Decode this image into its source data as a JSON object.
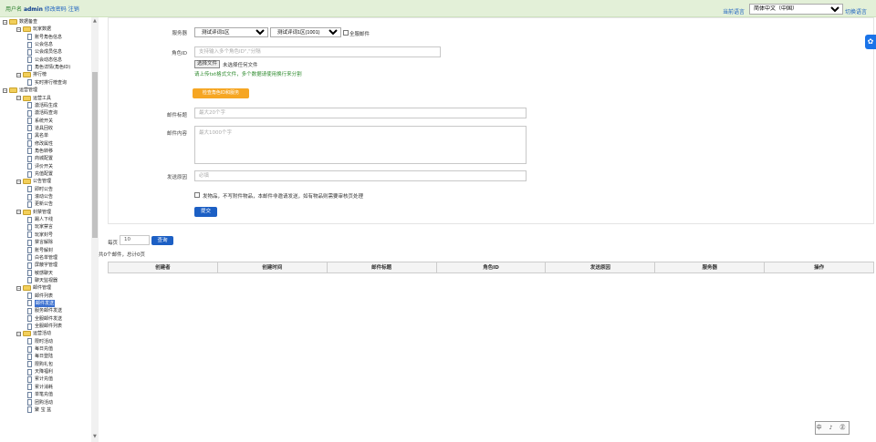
{
  "topbar": {
    "user_prefix": "用户名",
    "username": "admin",
    "change_password": "修改密码",
    "logout": "注销",
    "language_label": "当前语言",
    "language_value": "简体中文（中国）",
    "switch_language": "切换语言"
  },
  "sidebar": {
    "items": [
      {
        "label": "数据备查",
        "type": "folder",
        "level": 0
      },
      {
        "label": "玩家数据",
        "type": "folder",
        "level": 1
      },
      {
        "label": "账号角色信息",
        "type": "doc",
        "level": 2
      },
      {
        "label": "公会信息",
        "type": "doc",
        "level": 2
      },
      {
        "label": "公会成员信息",
        "type": "doc",
        "level": 2
      },
      {
        "label": "公会动态信息",
        "type": "doc",
        "level": 2
      },
      {
        "label": "角色详情(角色ID)",
        "type": "doc",
        "level": 2
      },
      {
        "label": "排行榜",
        "type": "folder",
        "level": 1
      },
      {
        "label": "实时排行榜查询",
        "type": "doc",
        "level": 2
      },
      {
        "label": "运营管理",
        "type": "folder",
        "level": 0
      },
      {
        "label": "运营工具",
        "type": "folder",
        "level": 1
      },
      {
        "label": "激活码生成",
        "type": "doc",
        "level": 2
      },
      {
        "label": "激活码查询",
        "type": "doc",
        "level": 2
      },
      {
        "label": "系统开关",
        "type": "doc",
        "level": 2
      },
      {
        "label": "道具回收",
        "type": "doc",
        "level": 2
      },
      {
        "label": "黑名单",
        "type": "doc",
        "level": 2
      },
      {
        "label": "修改属性",
        "type": "doc",
        "level": 2
      },
      {
        "label": "角色转移",
        "type": "doc",
        "level": 2
      },
      {
        "label": "商城配置",
        "type": "doc",
        "level": 2
      },
      {
        "label": "评价开关",
        "type": "doc",
        "level": 2
      },
      {
        "label": "充值配置",
        "type": "doc",
        "level": 2
      },
      {
        "label": "公告管理",
        "type": "folder",
        "level": 1
      },
      {
        "label": "即时公告",
        "type": "doc",
        "level": 2
      },
      {
        "label": "滚动公告",
        "type": "doc",
        "level": 2
      },
      {
        "label": "更新公告",
        "type": "doc",
        "level": 2
      },
      {
        "label": "封禁管理",
        "type": "folder",
        "level": 1
      },
      {
        "label": "踢人下线",
        "type": "doc",
        "level": 2
      },
      {
        "label": "玩家禁言",
        "type": "doc",
        "level": 2
      },
      {
        "label": "玩家封号",
        "type": "doc",
        "level": 2
      },
      {
        "label": "禁言解除",
        "type": "doc",
        "level": 2
      },
      {
        "label": "账号解封",
        "type": "doc",
        "level": 2
      },
      {
        "label": "白名单管理",
        "type": "doc",
        "level": 2
      },
      {
        "label": "屏蔽字管理",
        "type": "doc",
        "level": 2
      },
      {
        "label": "敏感聊天",
        "type": "doc",
        "level": 2
      },
      {
        "label": "聊天监视器",
        "type": "doc",
        "level": 2
      },
      {
        "label": "邮件管理",
        "type": "folder",
        "level": 1
      },
      {
        "label": "邮件列表",
        "type": "doc",
        "level": 2
      },
      {
        "label": "邮件发送",
        "type": "doc",
        "level": 2,
        "active": true
      },
      {
        "label": "服务邮件发送",
        "type": "doc",
        "level": 2
      },
      {
        "label": "全服邮件发送",
        "type": "doc",
        "level": 2
      },
      {
        "label": "全服邮件列表",
        "type": "doc",
        "level": 2
      },
      {
        "label": "运营活动",
        "type": "folder",
        "level": 1
      },
      {
        "label": "限时活动",
        "type": "doc",
        "level": 2
      },
      {
        "label": "每日充值",
        "type": "doc",
        "level": 2
      },
      {
        "label": "每日登陆",
        "type": "doc",
        "level": 2
      },
      {
        "label": "限购礼包",
        "type": "doc",
        "level": 2
      },
      {
        "label": "天降福利",
        "type": "doc",
        "level": 2
      },
      {
        "label": "累计充值",
        "type": "doc",
        "level": 2
      },
      {
        "label": "累计消耗",
        "type": "doc",
        "level": 2
      },
      {
        "label": "单笔充值",
        "type": "doc",
        "level": 2
      },
      {
        "label": "团购活动",
        "type": "doc",
        "level": 2
      },
      {
        "label": "聚 宝 盆",
        "type": "doc",
        "level": 2
      }
    ]
  },
  "form": {
    "server_label": "服务器",
    "server_group": "测试评词1区",
    "server_value": "测试评词1区(1001)",
    "all_server_mail": "全服邮件",
    "role_id_label": "角色ID",
    "role_id_placeholder": "支持输入多个角色ID\",\"分隔",
    "choose_file": "选择文件",
    "no_file": "未选择任何文件",
    "upload_hint": "请上传txt格式文件，多个数据请使用换行来分割",
    "check_role_btn": "检查角色ID和服务",
    "mail_title_label": "邮件标题",
    "mail_title_placeholder": "最大20个字",
    "mail_content_label": "邮件内容",
    "mail_content_placeholder": "最大1000个字",
    "send_reason_label": "发送原因",
    "send_reason_placeholder": "必填",
    "attach_note": "发物品，不写附件物品，本邮件非邀请发送，如有物品则需要审核页处理",
    "submit": "提交"
  },
  "list": {
    "per_page_label": "每页",
    "per_page_value": "10",
    "query_btn": "查询",
    "summary": "共0个邮件，总计0页",
    "columns": [
      "创建者",
      "创建时间",
      "邮件标题",
      "角色ID",
      "发送原因",
      "服务器",
      "操作"
    ]
  },
  "ime": "中 ♪ ㊣"
}
